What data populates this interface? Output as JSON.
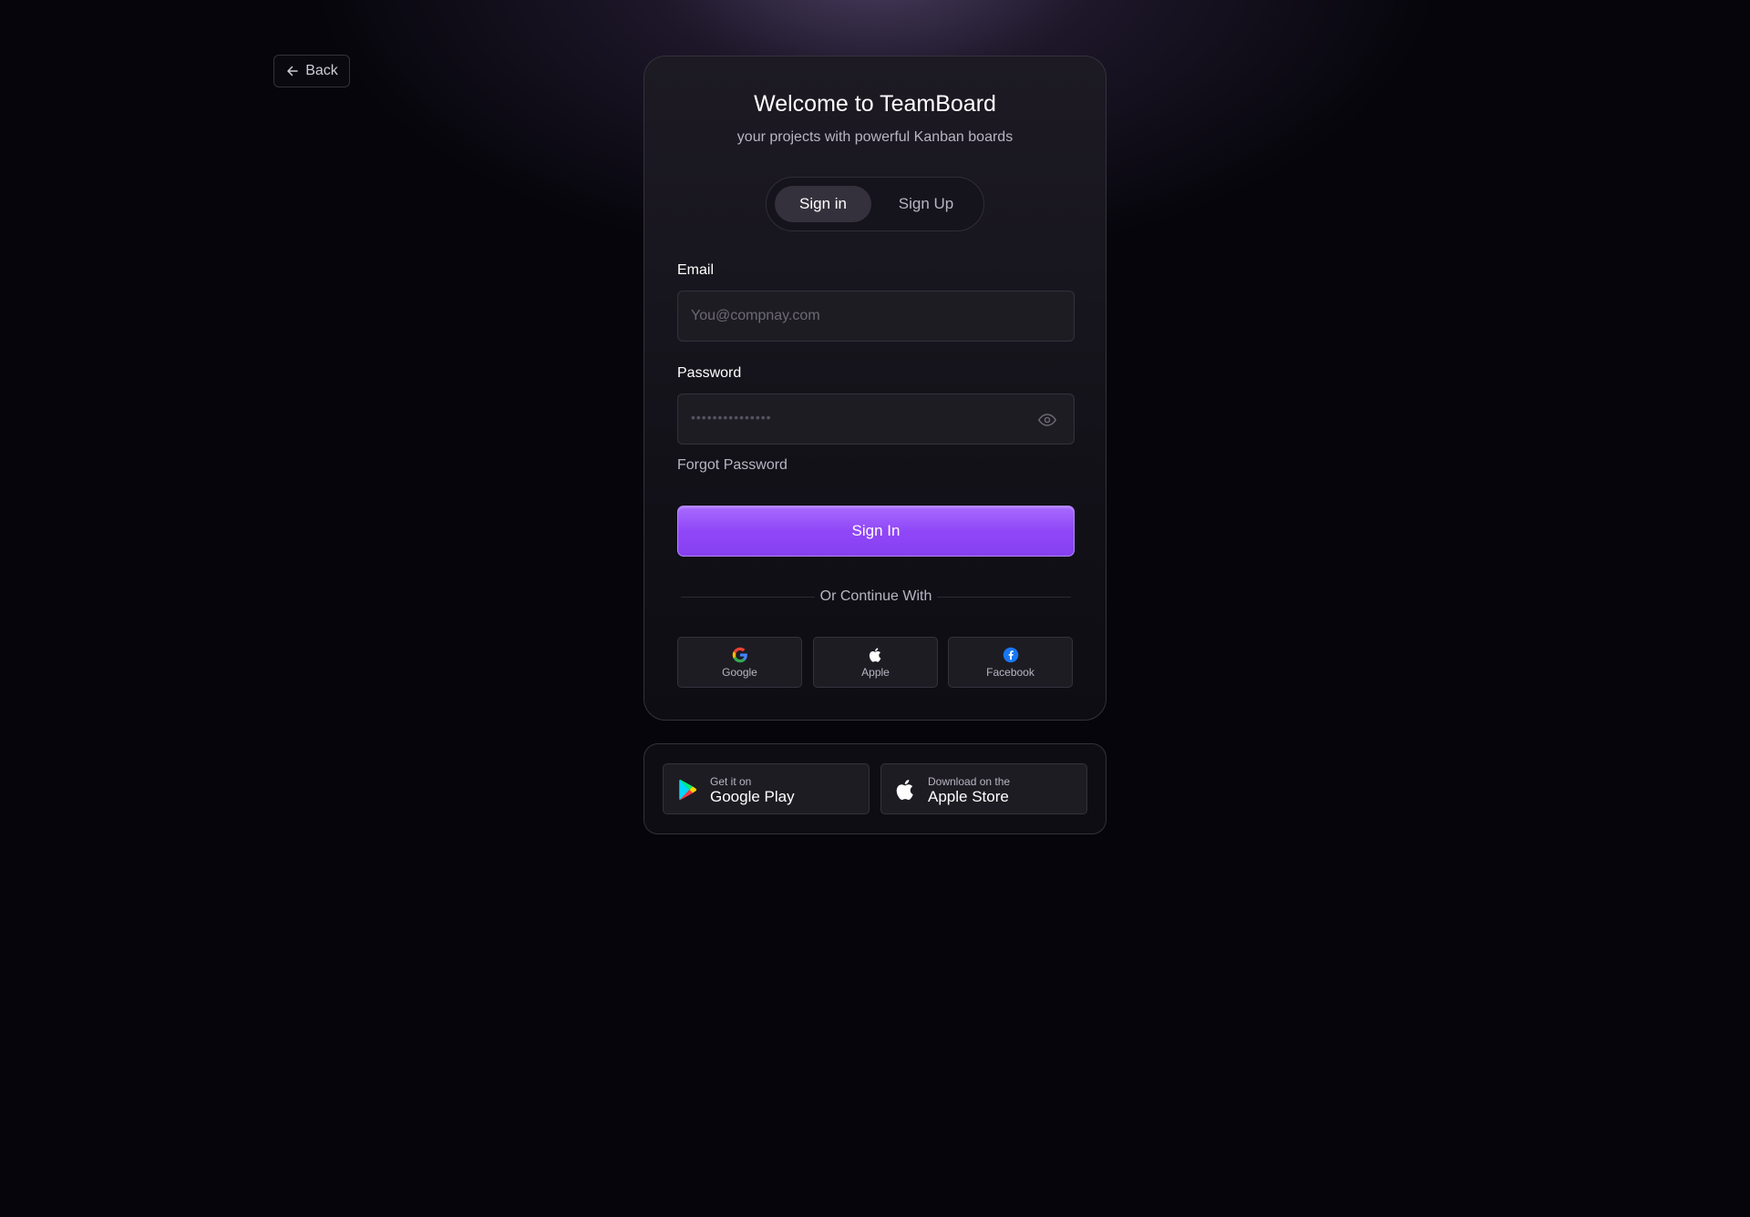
{
  "back": {
    "label": "Back"
  },
  "card": {
    "title": "Welcome to TeamBoard",
    "subtitle": "your projects with powerful Kanban boards"
  },
  "tabs": [
    {
      "label": "Sign in",
      "active": true
    },
    {
      "label": "Sign Up",
      "active": false
    }
  ],
  "form": {
    "email_label": "Email",
    "email_placeholder": "You@compnay.com",
    "email_value": "",
    "password_label": "Password",
    "password_mask": "•••••••••••••••",
    "forgot_label": "Forgot Password",
    "submit_label": "Sign In"
  },
  "divider": {
    "label": "Or Continue With"
  },
  "social": [
    {
      "label": "Google",
      "icon": "google-icon"
    },
    {
      "label": "Apple",
      "icon": "apple-icon"
    },
    {
      "label": "Facebook",
      "icon": "facebook-icon"
    }
  ],
  "stores": {
    "google_play": {
      "small": "Get it on",
      "big": "Google Play",
      "icon": "google-play-icon"
    },
    "apple_store": {
      "small": "Download on the",
      "big": "Apple Store",
      "icon": "apple-icon"
    }
  },
  "colors": {
    "background": "#06050b",
    "accent": "#9047f7",
    "card": "#111017",
    "border": "#34313c"
  }
}
